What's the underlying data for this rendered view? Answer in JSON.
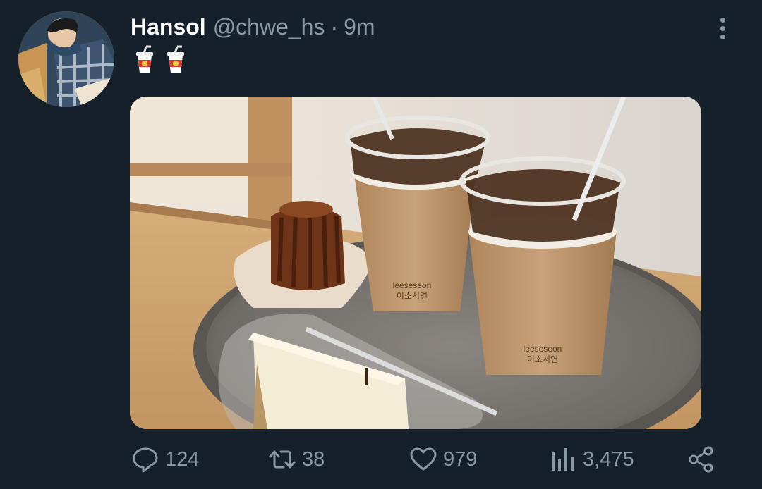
{
  "tweet": {
    "author_name": "Hansol",
    "handle": "@chwe_hs",
    "separator": "·",
    "time": "9m",
    "text_emoji": [
      "🥤",
      "🥤"
    ]
  },
  "media": {
    "cup_print_top": "leeseseon",
    "cup_print_bottom": "이소서연"
  },
  "actions": {
    "reply_count": "124",
    "retweet_count": "38",
    "like_count": "979",
    "views_count": "3,475"
  },
  "colors": {
    "background": "#15202b",
    "muted": "#8b98a5",
    "text": "#ffffff"
  },
  "icons": {
    "reply": "reply-icon",
    "retweet": "retweet-icon",
    "like": "heart-icon",
    "views": "views-icon",
    "share": "share-icon",
    "more": "more-vertical-icon"
  }
}
